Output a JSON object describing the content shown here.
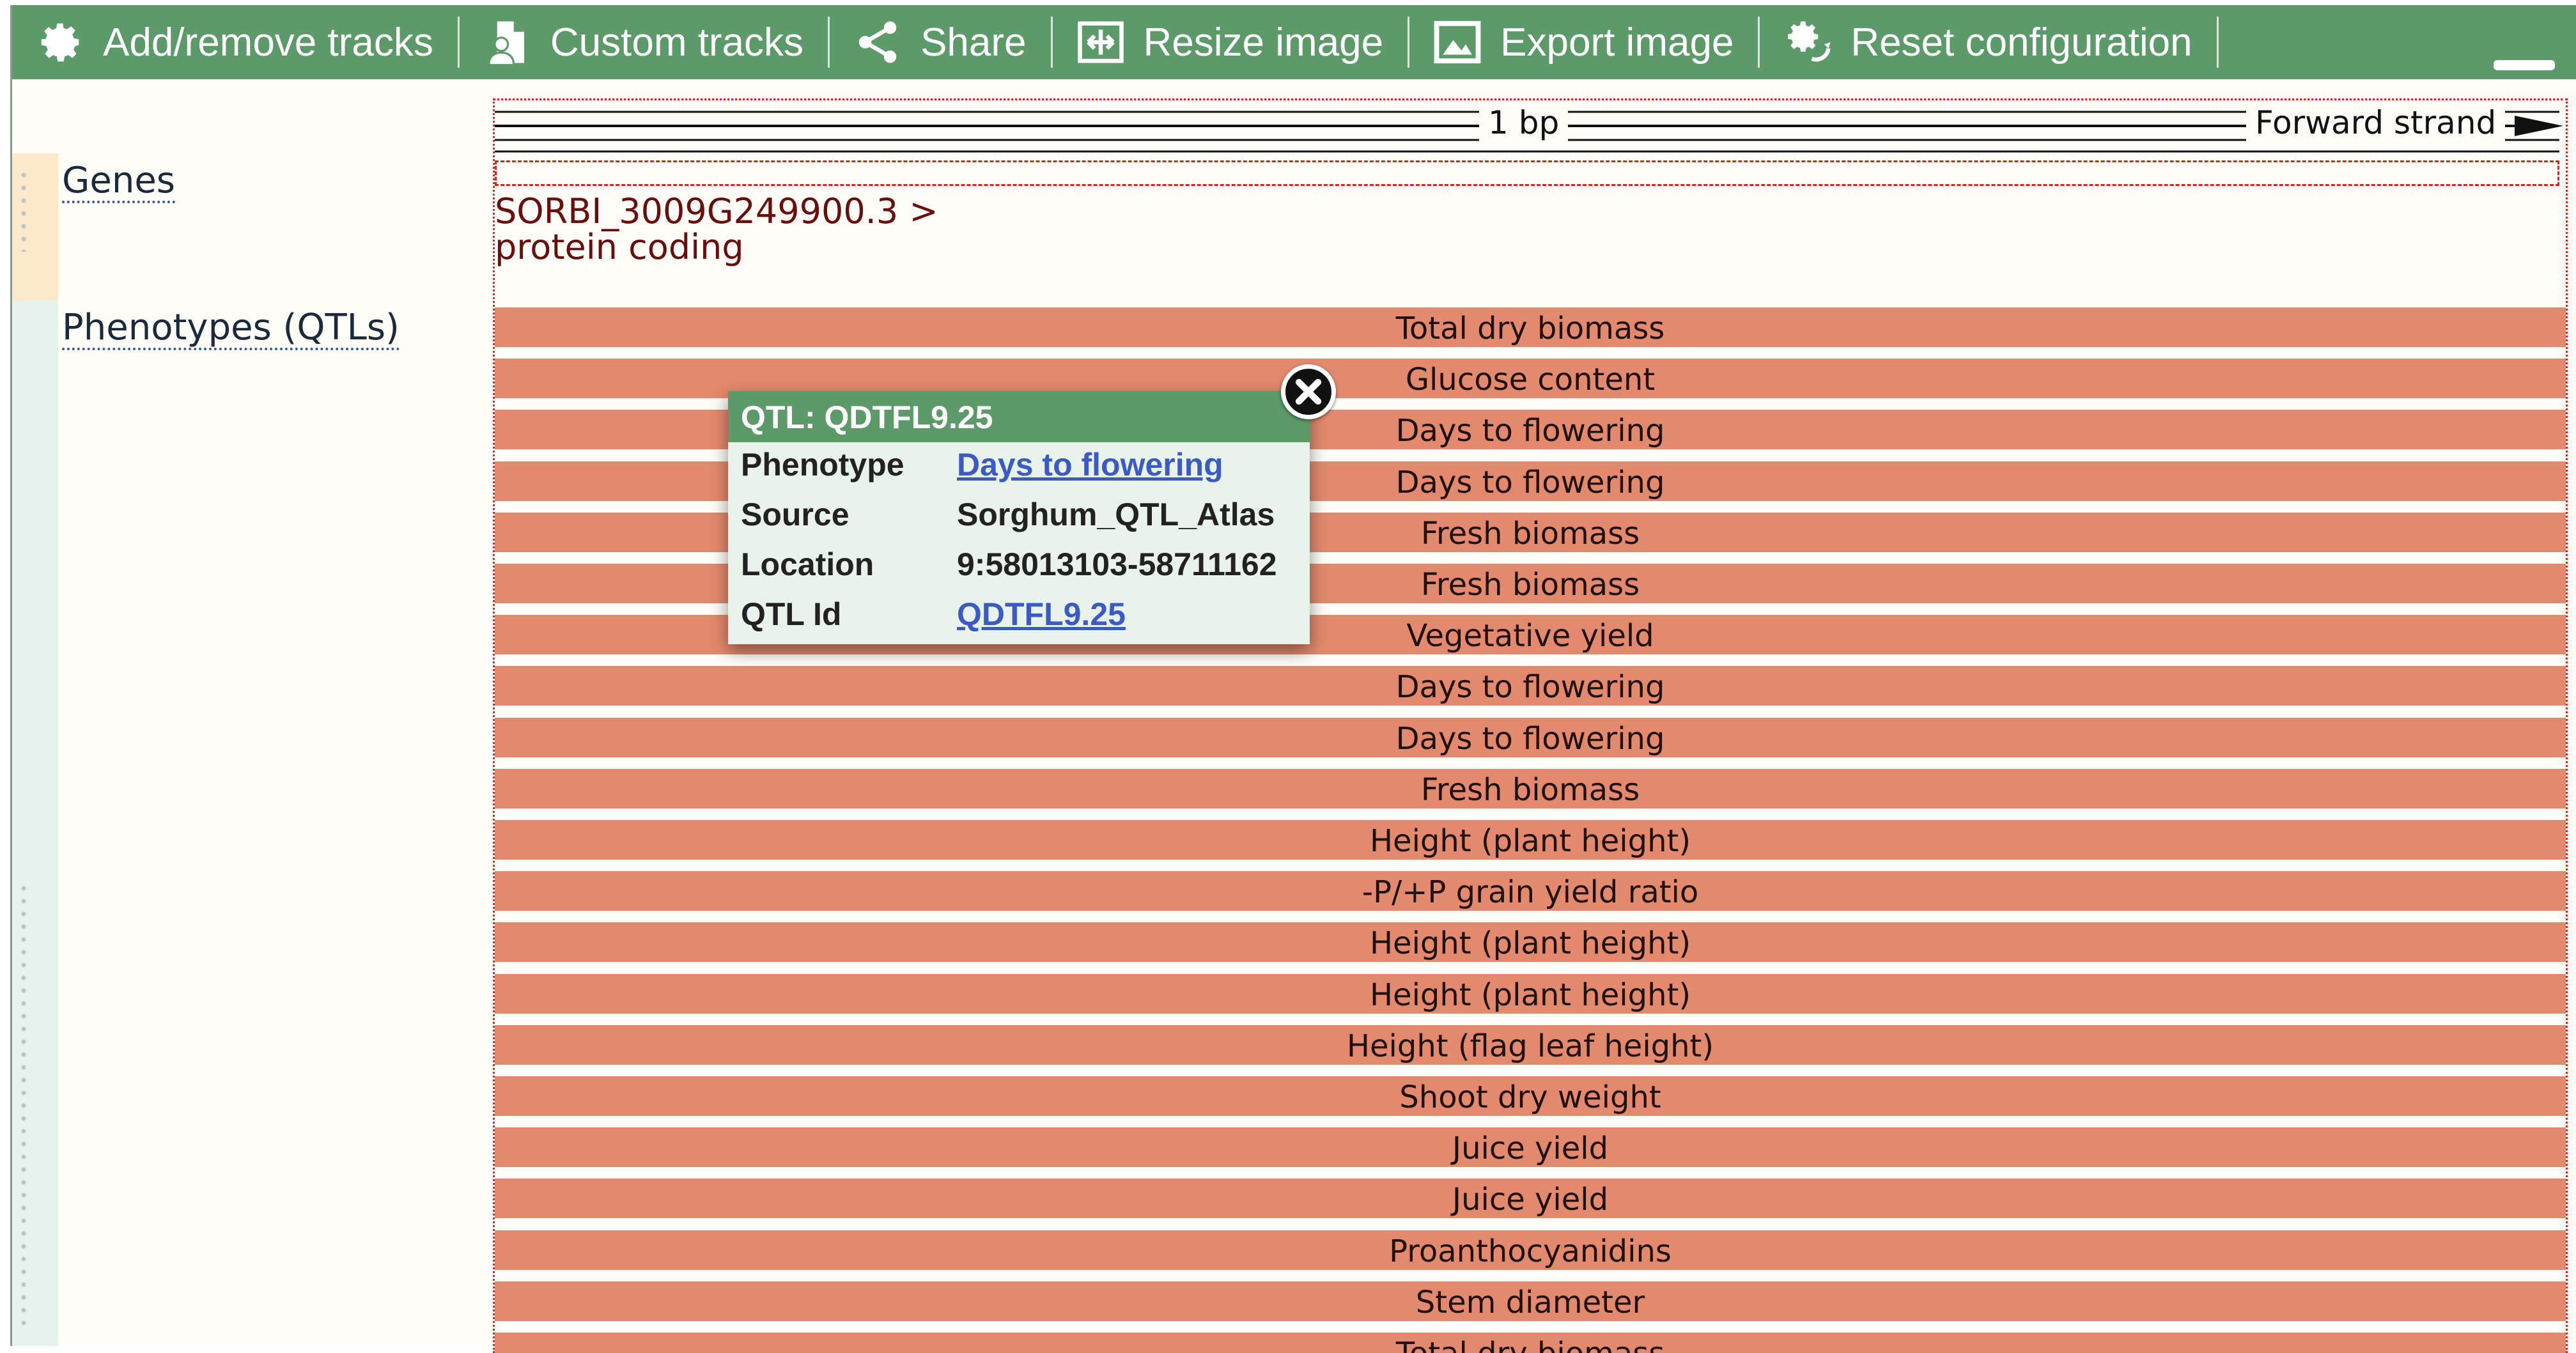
{
  "toolbar": {
    "buttons": [
      {
        "label": "Add/remove tracks",
        "icon": "gear-icon"
      },
      {
        "label": "Custom tracks",
        "icon": "file-user-icon"
      },
      {
        "label": "Share",
        "icon": "share-icon"
      },
      {
        "label": "Resize image",
        "icon": "resize-icon"
      },
      {
        "label": "Export image",
        "icon": "image-icon"
      },
      {
        "label": "Reset configuration",
        "icon": "reset-gear-icon"
      }
    ]
  },
  "tracks": {
    "genes_label": "Genes",
    "qtl_label": "Phenotypes (QTLs)"
  },
  "ruler": {
    "scale_label": "1 bp",
    "strand_label": "Forward strand"
  },
  "gene": {
    "id": "SORBI_3009G249900.3 >",
    "biotype": "protein coding"
  },
  "qtl_bars": [
    "Total dry biomass",
    "Glucose content",
    "Days to flowering",
    "Days to flowering",
    "Fresh biomass",
    "Fresh biomass",
    "Vegetative yield",
    "Days to flowering",
    "Days to flowering",
    "Fresh biomass",
    "Height (plant height)",
    "-P/+P grain yield ratio",
    "Height (plant height)",
    "Height (plant height)",
    "Height (flag leaf height)",
    "Shoot dry weight",
    "Juice yield",
    "Juice yield",
    "Proanthocyanidins",
    "Stem diameter",
    "Total dry biomass"
  ],
  "popup": {
    "title": "QTL: QDTFL9.25",
    "rows": [
      {
        "key": "Phenotype",
        "value": "Days to flowering"
      },
      {
        "key": "Source",
        "value": "Sorghum_QTL_Atlas"
      },
      {
        "key": "Location",
        "value": "9:58013103-58711162"
      },
      {
        "key": "QTL Id",
        "value": "QDTFL9.25"
      }
    ]
  },
  "colors": {
    "toolbar": "#5d9a6a",
    "qtl_bar": "#e38a6e",
    "gene_text": "#6a0d0d",
    "link": "#3a5bc7"
  }
}
